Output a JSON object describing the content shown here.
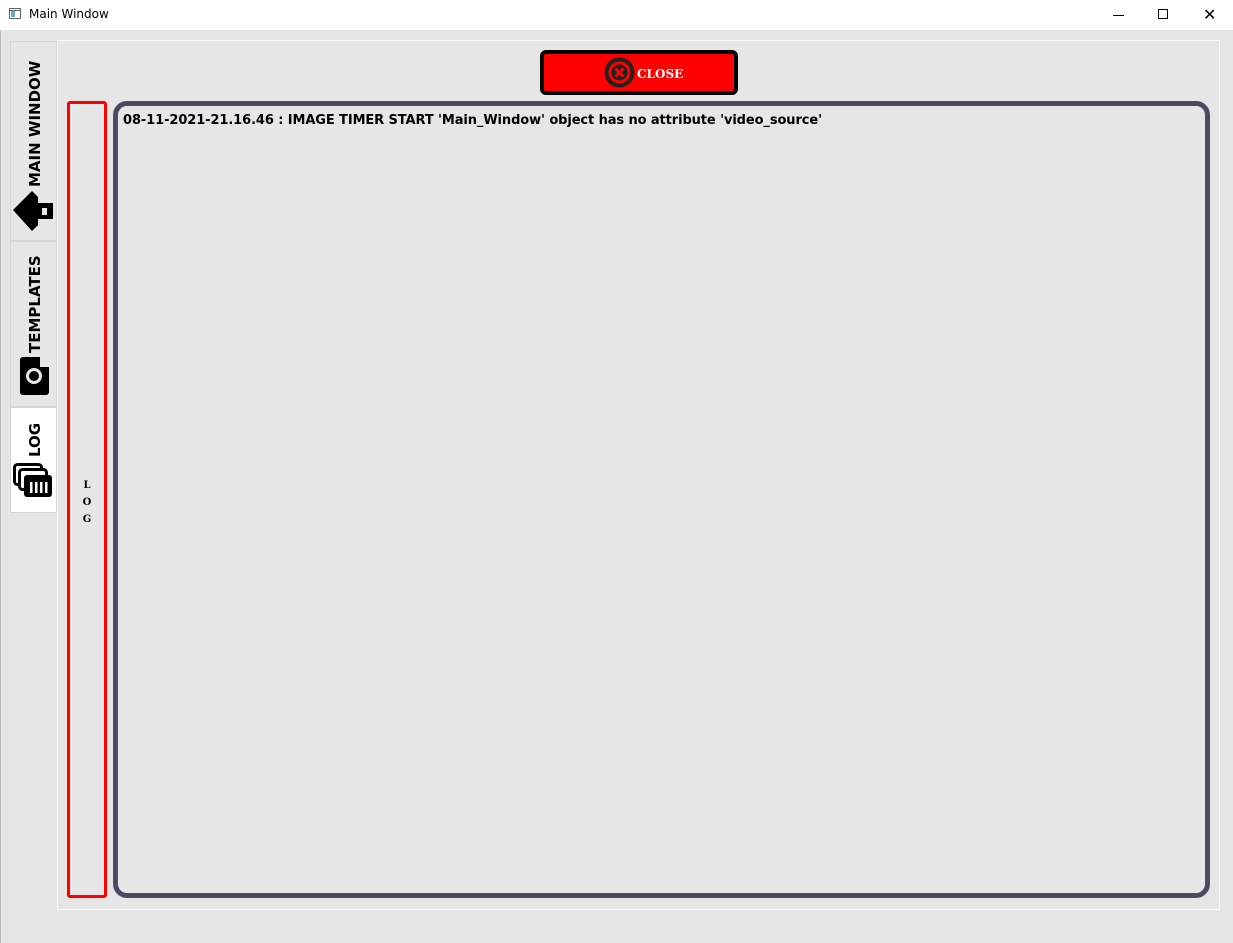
{
  "window": {
    "title": "Main Window",
    "controls": {
      "minimize": "—",
      "maximize": "☐",
      "close": "✕"
    }
  },
  "tabs": [
    {
      "label": "MAIN WINDOW",
      "icon": "home-icon",
      "active": false
    },
    {
      "label": "TEMPLATES",
      "icon": "camera-icon",
      "active": false
    },
    {
      "label": "LOG",
      "icon": "log-stack-icon",
      "active": true
    }
  ],
  "toolbar": {
    "close_label": "CLOSE",
    "close_icon": "close-circle-icon"
  },
  "log_panel": {
    "side_label_letters": [
      "L",
      "O",
      "G"
    ],
    "lines": [
      "08-11-2021-21.16.46 : IMAGE TIMER START 'Main_Window' object has no attribute 'video_source'"
    ]
  },
  "colors": {
    "close_button": "#ff0000",
    "log_side_border": "#ff0000",
    "log_box_border": "#4a4a63",
    "background": "#e6e6e6"
  }
}
